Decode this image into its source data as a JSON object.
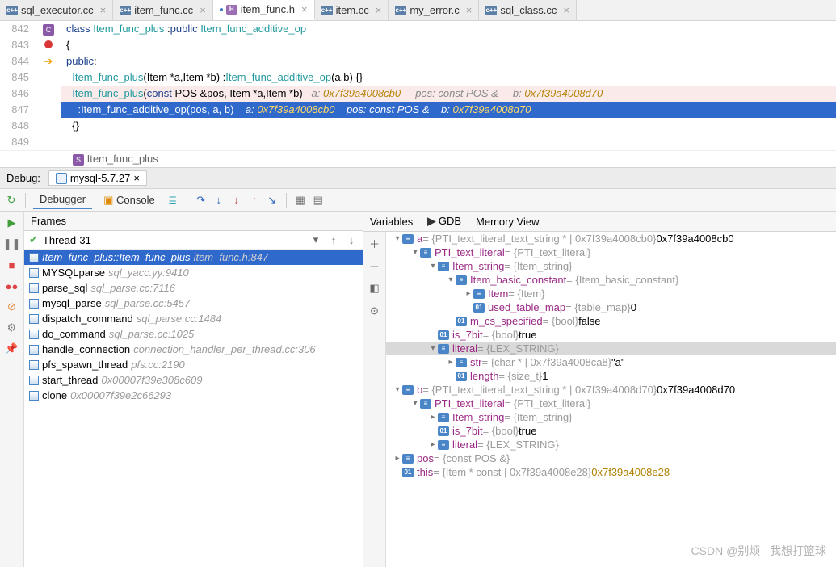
{
  "tabs": [
    {
      "label": "sql_executor.cc",
      "icon": "cpp",
      "active": false
    },
    {
      "label": "item_func.cc",
      "icon": "cpp",
      "active": false
    },
    {
      "label": "item_func.h",
      "icon": "h",
      "active": true
    },
    {
      "label": "item.cc",
      "icon": "cpp",
      "active": false
    },
    {
      "label": "my_error.c",
      "icon": "cpp",
      "active": false
    },
    {
      "label": "sql_class.cc",
      "icon": "cpp",
      "active": false
    }
  ],
  "editor": {
    "lines": [
      {
        "n": "842",
        "kind": "mark",
        "mark": "struct",
        "text": "class Item_func_plus :public Item_func_additive_op"
      },
      {
        "n": "843",
        "text": "{"
      },
      {
        "n": "844",
        "text": "public:"
      },
      {
        "n": "845",
        "text": "  Item_func_plus(Item *a,Item *b) :Item_func_additive_op(a,b) {}"
      },
      {
        "n": "846",
        "kind": "bp",
        "text": "  Item_func_plus(const POS &pos, Item *a,Item *b)   a: 0x7f39a4008cb0     pos: const POS &     b: 0x7f39a4008d70"
      },
      {
        "n": "847",
        "kind": "exec",
        "text": "    :Item_func_additive_op(pos, a, b)    a: 0x7f39a4008cb0    pos: const POS &    b: 0x7f39a4008d70"
      },
      {
        "n": "848",
        "text": "  {}"
      },
      {
        "n": "849",
        "text": ""
      }
    ]
  },
  "breadcrumb": "Item_func_plus",
  "debug": {
    "label": "Debug:",
    "config": "mysql-5.7.27"
  },
  "debug_tabs": {
    "debugger": "Debugger",
    "console": "Console"
  },
  "frames": {
    "title": "Frames",
    "thread": "Thread-31",
    "rows": [
      {
        "fn": "Item_func_plus::Item_func_plus",
        "loc": "item_func.h:847",
        "sel": true
      },
      {
        "fn": "MYSQLparse",
        "loc": "sql_yacc.yy:9410"
      },
      {
        "fn": "parse_sql",
        "loc": "sql_parse.cc:7116"
      },
      {
        "fn": "mysql_parse",
        "loc": "sql_parse.cc:5457"
      },
      {
        "fn": "dispatch_command",
        "loc": "sql_parse.cc:1484"
      },
      {
        "fn": "do_command",
        "loc": "sql_parse.cc:1025"
      },
      {
        "fn": "handle_connection",
        "loc": "connection_handler_per_thread.cc:306"
      },
      {
        "fn": "pfs_spawn_thread",
        "loc": "pfs.cc:2190"
      },
      {
        "fn": "start_thread",
        "loc": "0x00007f39e308c609"
      },
      {
        "fn": "clone",
        "loc": "0x00007f39e2c66293"
      }
    ]
  },
  "vars_header": {
    "variables": "Variables",
    "gdb": "GDB",
    "memory": "Memory View"
  },
  "vars": [
    {
      "d": 0,
      "c": "v",
      "i": "struct",
      "n": "a",
      "t": "= {PTI_text_literal_text_string * | 0x7f39a4008cb0} ",
      "v": "0x7f39a4008cb0"
    },
    {
      "d": 1,
      "c": "v",
      "i": "struct",
      "n": "PTI_text_literal",
      "t": " = {PTI_text_literal}",
      "v": ""
    },
    {
      "d": 2,
      "c": "v",
      "i": "struct",
      "n": "Item_string",
      "t": " = {Item_string}",
      "v": ""
    },
    {
      "d": 3,
      "c": "v",
      "i": "struct",
      "n": "Item_basic_constant",
      "t": " = {Item_basic_constant}",
      "v": ""
    },
    {
      "d": 4,
      "c": ">",
      "i": "struct",
      "n": "Item",
      "t": " = {Item}",
      "v": ""
    },
    {
      "d": 4,
      "c": " ",
      "i": "prim",
      "n": "used_table_map",
      "t": " = {table_map} ",
      "v": "0"
    },
    {
      "d": 3,
      "c": " ",
      "i": "prim",
      "n": "m_cs_specified",
      "t": " = {bool} ",
      "v": "false"
    },
    {
      "d": 2,
      "c": " ",
      "i": "prim",
      "n": "is_7bit",
      "t": " = {bool} ",
      "v": "true"
    },
    {
      "d": 2,
      "c": "v",
      "i": "struct",
      "n": "literal",
      "t": " = {LEX_STRING}",
      "v": "",
      "sel": true
    },
    {
      "d": 3,
      "c": ">",
      "i": "struct",
      "n": "str",
      "t": " = {char * | 0x7f39a4008ca8} ",
      "v": "\"a\""
    },
    {
      "d": 3,
      "c": " ",
      "i": "prim",
      "n": "length",
      "t": " = {size_t} ",
      "v": "1"
    },
    {
      "d": 0,
      "c": "v",
      "i": "struct",
      "n": "b",
      "t": " = {PTI_text_literal_text_string * | 0x7f39a4008d70} ",
      "v": "0x7f39a4008d70"
    },
    {
      "d": 1,
      "c": "v",
      "i": "struct",
      "n": "PTI_text_literal",
      "t": " = {PTI_text_literal}",
      "v": ""
    },
    {
      "d": 2,
      "c": ">",
      "i": "struct",
      "n": "Item_string",
      "t": " = {Item_string}",
      "v": ""
    },
    {
      "d": 2,
      "c": " ",
      "i": "prim",
      "n": "is_7bit",
      "t": " = {bool} ",
      "v": "true"
    },
    {
      "d": 2,
      "c": ">",
      "i": "struct",
      "n": "literal",
      "t": " = {LEX_STRING}",
      "v": ""
    },
    {
      "d": 0,
      "c": ">",
      "i": "struct",
      "n": "pos",
      "t": " = {const POS &}",
      "v": ""
    },
    {
      "d": 0,
      "c": " ",
      "i": "prim",
      "n": "this",
      "t": " = {Item * const | 0x7f39a4008e28} ",
      "v": "0x7f39a4008e28",
      "gold": true
    }
  ],
  "watermark": "CSDN @别烦_ 我想打篮球"
}
